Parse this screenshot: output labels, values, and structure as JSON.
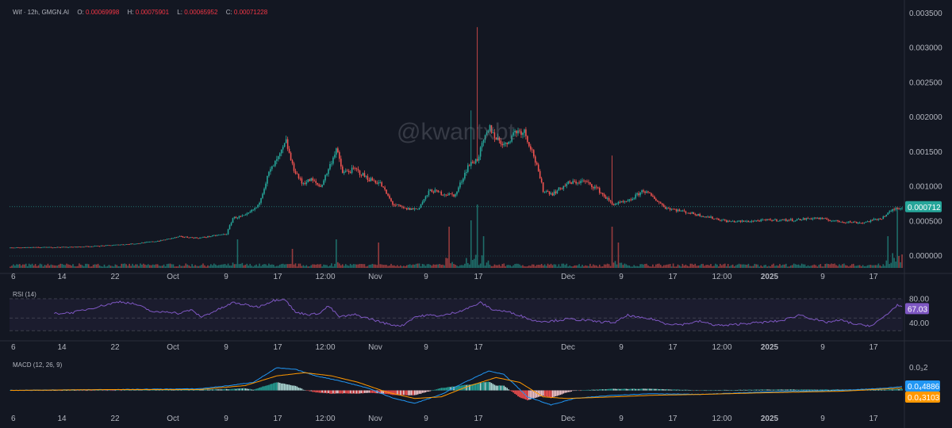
{
  "header": {
    "symbol": "Wif · 12h, GMGN.AI",
    "o_label": "O:",
    "o_value": "0.00069998",
    "h_label": "H:",
    "h_value": "0.00075901",
    "l_label": "L:",
    "l_value": "0.00065952",
    "c_label": "C:",
    "c_value": "0.00071228"
  },
  "watermark": "@kwantxbt",
  "colors": {
    "up": "#26a69a",
    "down": "#ef5350",
    "rsi": "#7e57c2",
    "macd": "#2196f3",
    "signal": "#ff9800",
    "bg": "#131722"
  },
  "chart_data": [
    {
      "type": "candlestick",
      "title": "",
      "price_axis": {
        "ticks": [
          "0.003500",
          "0.003000",
          "0.002500",
          "0.002000",
          "0.001500",
          "0.001000",
          "0.000500",
          "0.000000"
        ],
        "ylim": [
          -0.00017,
          0.0036
        ]
      },
      "last_price": {
        "label": "0.000712",
        "value": 0.000712
      },
      "x_labels": [
        "6",
        "14",
        "22",
        "Oct",
        "9",
        "17",
        "12:00",
        "Nov",
        "9",
        "17",
        "Dec",
        "9",
        "17",
        "12:00",
        "2025",
        "9",
        "17"
      ],
      "close_path": [
        [
          0,
          0.00012
        ],
        [
          16,
          0.000125
        ],
        [
          40,
          0.00013
        ],
        [
          60,
          0.00015
        ],
        [
          80,
          0.00018
        ],
        [
          95,
          0.00022
        ],
        [
          108,
          0.00028
        ],
        [
          120,
          0.00026
        ],
        [
          138,
          0.00032
        ],
        [
          142,
          0.00055
        ],
        [
          150,
          0.00058
        ],
        [
          158,
          0.00072
        ],
        [
          165,
          0.0012
        ],
        [
          172,
          0.00145
        ],
        [
          176,
          0.00165
        ],
        [
          180,
          0.0013
        ],
        [
          186,
          0.00105
        ],
        [
          192,
          0.0011
        ],
        [
          198,
          0.001
        ],
        [
          203,
          0.00125
        ],
        [
          208,
          0.00155
        ],
        [
          212,
          0.0012
        ],
        [
          220,
          0.00125
        ],
        [
          228,
          0.00112
        ],
        [
          236,
          0.00105
        ],
        [
          244,
          0.00075
        ],
        [
          252,
          0.00068
        ],
        [
          260,
          0.00068
        ],
        [
          268,
          0.00095
        ],
        [
          276,
          0.0009
        ],
        [
          284,
          0.00088
        ],
        [
          292,
          0.0013
        ],
        [
          298,
          0.0014
        ],
        [
          302,
          0.00165
        ],
        [
          306,
          0.00185
        ],
        [
          310,
          0.0017
        ],
        [
          316,
          0.0016
        ],
        [
          322,
          0.0018
        ],
        [
          328,
          0.0018
        ],
        [
          334,
          0.00145
        ],
        [
          340,
          0.00095
        ],
        [
          346,
          0.0009
        ],
        [
          356,
          0.00105
        ],
        [
          366,
          0.00108
        ],
        [
          374,
          0.00098
        ],
        [
          384,
          0.00075
        ],
        [
          394,
          0.00078
        ],
        [
          404,
          0.00095
        ],
        [
          410,
          0.00085
        ],
        [
          418,
          0.0007
        ],
        [
          428,
          0.00065
        ],
        [
          438,
          0.0006
        ],
        [
          448,
          0.00055
        ],
        [
          458,
          0.0005
        ],
        [
          470,
          0.0005
        ],
        [
          484,
          0.00052
        ],
        [
          500,
          0.00052
        ],
        [
          514,
          0.00055
        ],
        [
          528,
          0.0005
        ],
        [
          544,
          0.00048
        ],
        [
          556,
          0.00055
        ],
        [
          564,
          0.00068
        ],
        [
          570,
          0.00071
        ]
      ],
      "volume_peaks": [
        [
          145,
          0.45
        ],
        [
          180,
          0.3
        ],
        [
          208,
          0.45
        ],
        [
          235,
          0.4
        ],
        [
          280,
          0.65
        ],
        [
          294,
          0.75
        ],
        [
          298,
          1.0
        ],
        [
          302,
          0.5
        ],
        [
          384,
          0.65
        ],
        [
          388,
          0.4
        ],
        [
          560,
          0.5
        ],
        [
          566,
          0.95
        ]
      ]
    },
    {
      "type": "line",
      "title": "RSI (14)",
      "ticks": [
        "80.00",
        "40.00"
      ],
      "last_value_label": "67.03",
      "ylim": [
        20,
        95
      ],
      "band": [
        30,
        70
      ],
      "x_labels": [
        "6",
        "14",
        "22",
        "Oct",
        "9",
        "17",
        "12:00",
        "Nov",
        "9",
        "17",
        "Dec",
        "9",
        "17",
        "12:00",
        "2025",
        "9",
        "17"
      ],
      "path": [
        [
          28,
          58
        ],
        [
          40,
          60
        ],
        [
          55,
          70
        ],
        [
          70,
          80
        ],
        [
          80,
          75
        ],
        [
          92,
          60
        ],
        [
          100,
          62
        ],
        [
          108,
          58
        ],
        [
          115,
          65
        ],
        [
          122,
          52
        ],
        [
          138,
          72
        ],
        [
          142,
          78
        ],
        [
          148,
          75
        ],
        [
          158,
          70
        ],
        [
          168,
          82
        ],
        [
          175,
          85
        ],
        [
          182,
          60
        ],
        [
          192,
          56
        ],
        [
          198,
          60
        ],
        [
          203,
          72
        ],
        [
          210,
          52
        ],
        [
          220,
          56
        ],
        [
          230,
          48
        ],
        [
          242,
          38
        ],
        [
          250,
          36
        ],
        [
          258,
          52
        ],
        [
          266,
          55
        ],
        [
          276,
          54
        ],
        [
          286,
          62
        ],
        [
          294,
          70
        ],
        [
          300,
          78
        ],
        [
          308,
          65
        ],
        [
          316,
          62
        ],
        [
          324,
          56
        ],
        [
          334,
          45
        ],
        [
          344,
          44
        ],
        [
          356,
          48
        ],
        [
          366,
          46
        ],
        [
          376,
          43
        ],
        [
          386,
          42
        ],
        [
          394,
          55
        ],
        [
          402,
          50
        ],
        [
          410,
          48
        ],
        [
          418,
          40
        ],
        [
          428,
          38
        ],
        [
          440,
          44
        ],
        [
          448,
          38
        ],
        [
          456,
          36
        ],
        [
          468,
          40
        ],
        [
          480,
          42
        ],
        [
          492,
          45
        ],
        [
          504,
          56
        ],
        [
          512,
          48
        ],
        [
          520,
          42
        ],
        [
          530,
          46
        ],
        [
          540,
          38
        ],
        [
          550,
          36
        ],
        [
          560,
          58
        ],
        [
          566,
          74
        ],
        [
          570,
          67
        ]
      ]
    },
    {
      "type": "line",
      "title": "MACD (12, 26, 9)",
      "ticks": [
        "0.0₃2"
      ],
      "last_value_labels": [
        "0.0₄4886",
        "0.0₄3103"
      ],
      "ylim": [
        -0.00025,
        0.00032
      ],
      "x_labels": [
        "6",
        "14",
        "22",
        "Oct",
        "9",
        "17",
        "12:00",
        "Nov",
        "9",
        "17",
        "Dec",
        "9",
        "17",
        "12:00",
        "2025",
        "9",
        "17"
      ],
      "macd": [
        [
          0,
          0
        ],
        [
          60,
          1e-05
        ],
        [
          120,
          2e-05
        ],
        [
          140,
          6e-05
        ],
        [
          155,
          0.0001
        ],
        [
          170,
          0.00028
        ],
        [
          182,
          0.00026
        ],
        [
          195,
          0.00018
        ],
        [
          210,
          0.00012
        ],
        [
          228,
          3e-05
        ],
        [
          245,
          -0.0001
        ],
        [
          258,
          -0.00016
        ],
        [
          275,
          -5e-05
        ],
        [
          290,
          0.0001
        ],
        [
          305,
          0.00024
        ],
        [
          315,
          0.0002
        ],
        [
          330,
          -8e-05
        ],
        [
          345,
          -0.00018
        ],
        [
          360,
          -0.0001
        ],
        [
          385,
          -6e-05
        ],
        [
          410,
          -4e-05
        ],
        [
          440,
          -5e-05
        ],
        [
          480,
          -2e-05
        ],
        [
          530,
          0
        ],
        [
          560,
          3e-05
        ],
        [
          570,
          5e-05
        ]
      ],
      "signal": [
        [
          0,
          0
        ],
        [
          60,
          1e-05
        ],
        [
          120,
          1e-05
        ],
        [
          150,
          6e-05
        ],
        [
          170,
          0.00018
        ],
        [
          188,
          0.00022
        ],
        [
          205,
          0.00018
        ],
        [
          222,
          0.0001
        ],
        [
          240,
          -2e-05
        ],
        [
          258,
          -0.0001
        ],
        [
          275,
          -8e-05
        ],
        [
          292,
          5e-05
        ],
        [
          310,
          0.00016
        ],
        [
          325,
          0.0001
        ],
        [
          340,
          -8e-05
        ],
        [
          355,
          -0.0001
        ],
        [
          385,
          -8e-05
        ],
        [
          410,
          -6e-05
        ],
        [
          440,
          -5e-05
        ],
        [
          480,
          -3e-05
        ],
        [
          530,
          -1e-05
        ],
        [
          560,
          2e-05
        ],
        [
          570,
          3e-05
        ]
      ]
    }
  ]
}
